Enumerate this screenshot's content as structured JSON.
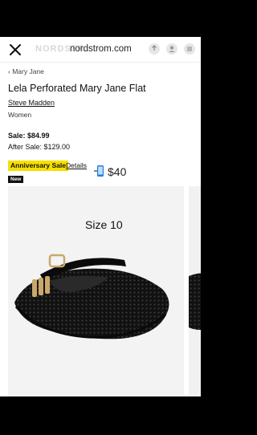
{
  "topbar": {
    "ghost_logo": "NORDSTR",
    "url": "nordstrom.com"
  },
  "breadcrumb": {
    "label": "Mary Jane"
  },
  "product": {
    "title": "Lela Perforated Mary Jane Flat",
    "brand": "Steve Madden",
    "gender": "Women",
    "sale_price": "Sale: $84.99",
    "after_sale_price": "After Sale: $129.00",
    "promo_label": "Anniversary Sale",
    "details_link": "Details",
    "price_note": "$40",
    "badge": "New"
  },
  "gallery": {
    "size_note": "Size 10"
  },
  "colors": {
    "promo_bg": "#f6e000",
    "page_bg": "#ffffff",
    "frame_bg": "#000000"
  },
  "icons": [
    "close-icon",
    "share-icon",
    "user-icon",
    "menu-icon",
    "chevron-left-icon",
    "phone-icon"
  ]
}
